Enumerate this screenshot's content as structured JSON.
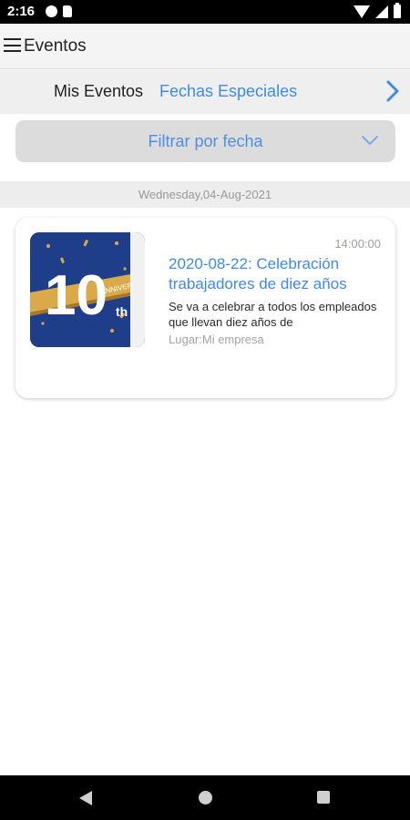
{
  "status_bar": {
    "time": "2:16",
    "icons": [
      "notification-icon",
      "sim-card-icon",
      "wifi-icon",
      "signal-icon",
      "battery-icon"
    ]
  },
  "app_bar": {
    "title": "Eventos",
    "menu_icon": "hamburger-menu-icon"
  },
  "tabs": [
    {
      "label": "Mis Eventos",
      "active": false
    },
    {
      "label": "Fechas Especiales",
      "active": true
    }
  ],
  "filter": {
    "label": "Filtrar por fecha",
    "icon": "chevron-down-icon"
  },
  "date_header": "Wednesday,04-Aug-2021",
  "events": [
    {
      "time": "14:00:00",
      "title": "2020-08-22: Celebración trabajadores de diez años",
      "description": "Se va a celebrar a todos los empleados que llevan diez años de",
      "place": "Lugar:Mi empresa",
      "image": {
        "number_text": "10",
        "suffix_text": "th",
        "ribbon_text": "ANNIVER"
      }
    }
  ],
  "nav_bar": {
    "icons": [
      "back-icon",
      "home-icon",
      "recents-icon"
    ]
  },
  "colors": {
    "accent": "#3f8ae6",
    "app_bar_bg": "#f4f4f4",
    "filter_bg": "#dcdcdc",
    "thumb_bg": "#1f3e8a",
    "gold": "#d9a94a"
  }
}
